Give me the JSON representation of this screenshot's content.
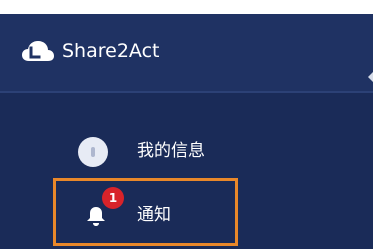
{
  "header": {
    "brand": "Share2Act",
    "logo_icon": "cloud-logo-icon"
  },
  "nav": {
    "items": [
      {
        "label": "我的信息",
        "icon": "avatar"
      },
      {
        "label": "通知",
        "icon": "bell-icon",
        "badge": "1"
      }
    ]
  },
  "colors": {
    "header_bg": "#1f3263",
    "nav_bg": "#1a2b58",
    "highlight": "#e9882a",
    "badge": "#d8232a",
    "text": "#ffffff"
  }
}
